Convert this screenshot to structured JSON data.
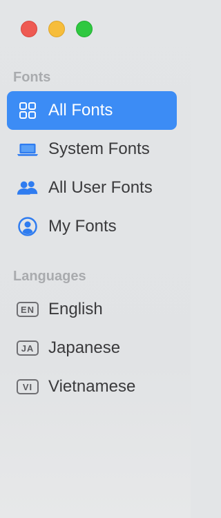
{
  "window": {
    "controls": [
      "close",
      "minimize",
      "maximize"
    ]
  },
  "sidebar": {
    "sections": [
      {
        "header": "Fonts",
        "items": [
          {
            "label": "All Fonts",
            "icon": "grid-icon",
            "selected": true
          },
          {
            "label": "System Fonts",
            "icon": "laptop-icon",
            "selected": false
          },
          {
            "label": "All User Fonts",
            "icon": "people-icon",
            "selected": false
          },
          {
            "label": "My Fonts",
            "icon": "person-circle-icon",
            "selected": false
          }
        ]
      },
      {
        "header": "Languages",
        "items": [
          {
            "label": "English",
            "badge": "EN",
            "icon": "language-badge-icon"
          },
          {
            "label": "Japanese",
            "badge": "JA",
            "icon": "language-badge-icon"
          },
          {
            "label": "Vietnamese",
            "badge": "VI",
            "icon": "language-badge-icon"
          }
        ]
      }
    ]
  },
  "colors": {
    "accent": "#3c8cf5",
    "icon_blue": "#2f7cf0",
    "sidebar_bg": "#e3e5e7",
    "section_header": "#a9abae",
    "text": "#3a3a3c"
  }
}
